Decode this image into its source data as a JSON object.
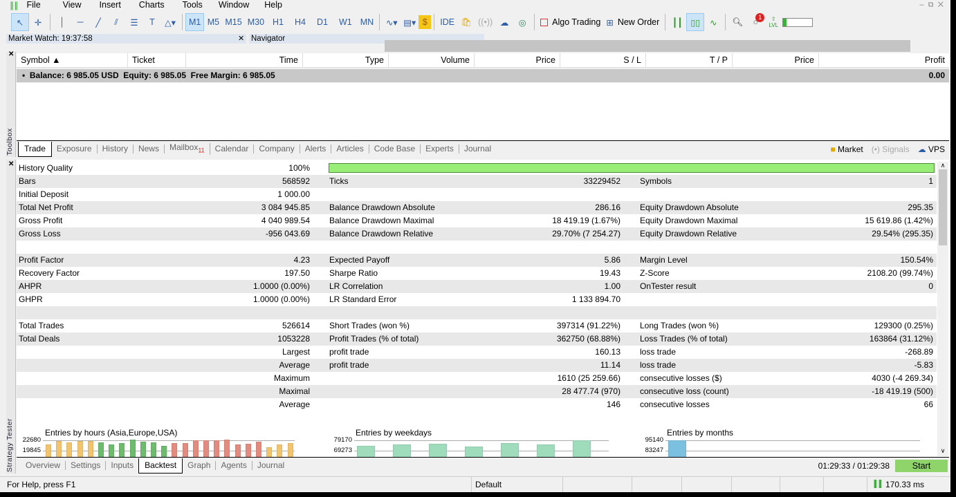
{
  "menu": {
    "items": [
      "File",
      "View",
      "Insert",
      "Charts",
      "Tools",
      "Window",
      "Help"
    ]
  },
  "toolbar": {
    "timeframes": [
      "M1",
      "M5",
      "M15",
      "M30",
      "H1",
      "H4",
      "D1",
      "W1",
      "MN"
    ],
    "active_timeframe": "M1",
    "ide": "IDE",
    "algo_trading": "Algo Trading",
    "new_order": "New Order",
    "notification_count": "1",
    "lvl": "LVL"
  },
  "panels": {
    "market_watch": "Market Watch: 19:37:58",
    "navigator": "Navigator"
  },
  "toolbox": {
    "label": "Toolbox",
    "columns": [
      "Symbol",
      "Ticket",
      "Time",
      "Type",
      "Volume",
      "Price",
      "S / L",
      "T / P",
      "Price",
      "Profit"
    ],
    "balance_line": "Balance: 6 985.05 USD  Equity: 6 985.05  Free Margin: 6 985.05",
    "balance_profit": "0.00",
    "tabs": [
      "Trade",
      "Exposure",
      "History",
      "News",
      "Mailbox",
      "Calendar",
      "Company",
      "Alerts",
      "Articles",
      "Code Base",
      "Experts",
      "Journal"
    ],
    "active_tab": "Trade",
    "mailbox_count": "11",
    "right": {
      "market": "Market",
      "signals": "Signals",
      "vps": "VPS"
    }
  },
  "tester": {
    "label": "Strategy Tester",
    "history_quality_pct": 100,
    "rows": [
      [
        "History Quality",
        "100%",
        "",
        "",
        "",
        ""
      ],
      [
        "Bars",
        "568592",
        "Ticks",
        "33229452",
        "Symbols",
        "1"
      ],
      [
        "Initial Deposit",
        "1 000.00",
        "",
        "",
        "",
        ""
      ],
      [
        "Total Net Profit",
        "3 084 945.85",
        "Balance Drawdown Absolute",
        "286.16",
        "Equity Drawdown Absolute",
        "295.35"
      ],
      [
        "Gross Profit",
        "4 040 989.54",
        "Balance Drawdown Maximal",
        "18 419.19 (1.67%)",
        "Equity Drawdown Maximal",
        "15 619.86 (1.42%)"
      ],
      [
        "Gross Loss",
        "-956 043.69",
        "Balance Drawdown Relative",
        "29.70% (7 254.27)",
        "Equity Drawdown Relative",
        "29.54% (295.35)"
      ],
      [
        "",
        "",
        "",
        "",
        "",
        ""
      ],
      [
        "Profit Factor",
        "4.23",
        "Expected Payoff",
        "5.86",
        "Margin Level",
        "150.54%"
      ],
      [
        "Recovery Factor",
        "197.50",
        "Sharpe Ratio",
        "19.43",
        "Z-Score",
        "2108.20 (99.74%)"
      ],
      [
        "AHPR",
        "1.0000 (0.00%)",
        "LR Correlation",
        "1.00",
        "OnTester result",
        "0"
      ],
      [
        "GHPR",
        "1.0000 (0.00%)",
        "LR Standard Error",
        "1 133 894.70",
        "",
        ""
      ],
      [
        "",
        "",
        "",
        "",
        "",
        ""
      ],
      [
        "Total Trades",
        "526614",
        "Short Trades (won %)",
        "397314 (91.22%)",
        "Long Trades (won %)",
        "129300 (0.25%)"
      ],
      [
        "Total Deals",
        "1053228",
        "Profit Trades (% of total)",
        "362750 (68.88%)",
        "Loss Trades (% of total)",
        "163864 (31.12%)"
      ],
      [
        "",
        "Largest",
        "profit trade",
        "160.13",
        "loss trade",
        "-268.89"
      ],
      [
        "",
        "Average",
        "profit trade",
        "11.14",
        "loss trade",
        "-5.83"
      ],
      [
        "",
        "Maximum",
        "",
        "1610 (25 259.66)",
        "consecutive losses ($)",
        "4030 (-4 269.34)"
      ],
      [
        "",
        "Maximal",
        "",
        "28 477.74 (970)",
        "consecutive loss (count)",
        "-18 419.19 (500)"
      ],
      [
        "",
        "Average",
        "",
        "146",
        "consecutive losses",
        "66"
      ]
    ],
    "tabs": [
      "Overview",
      "Settings",
      "Inputs",
      "Backtest",
      "Graph",
      "Agents",
      "Journal"
    ],
    "active_tab": "Backtest",
    "time": "01:29:33 / 01:29:38",
    "start": "Start"
  },
  "chart_data": [
    {
      "type": "bar",
      "title": "Entries by hours (Asia,Europe,USA)",
      "yticks": [
        "22680",
        "19845"
      ],
      "values": [
        21550,
        22490,
        22110,
        22490,
        22490,
        22110,
        21550,
        21920,
        22870,
        22300,
        22110,
        21170,
        21920,
        21920,
        22680,
        22680,
        22680,
        22870,
        21550,
        21730,
        22300,
        20790,
        21550,
        21920
      ],
      "colors": [
        "#f2c46e",
        "#f2c46e",
        "#f2c46e",
        "#f2c46e",
        "#f2c46e",
        "#6dbb6d",
        "#6dbb6d",
        "#6dbb6d",
        "#6dbb6d",
        "#6dbb6d",
        "#6dbb6d",
        "#6dbb6d",
        "#e38b7e",
        "#e38b7e",
        "#e38b7e",
        "#e38b7e",
        "#e38b7e",
        "#e38b7e",
        "#e38b7e",
        "#e38b7e",
        "#e38b7e",
        "#f2c46e",
        "#f2c46e",
        "#f2c46e"
      ]
    },
    {
      "type": "bar",
      "title": "Entries by weekdays",
      "yticks": [
        "79170",
        "69273"
      ],
      "values": [
        73600,
        75460,
        76080,
        72990,
        76700,
        75460,
        79170
      ],
      "color": "#9fdcbc"
    },
    {
      "type": "bar",
      "title": "Entries by months",
      "yticks": [
        "95140",
        "83247"
      ],
      "values": [
        95140
      ],
      "color": "#7cc0e0"
    }
  ],
  "status": {
    "help": "For Help, press F1",
    "profile": "Default",
    "ping": "170.33 ms"
  }
}
